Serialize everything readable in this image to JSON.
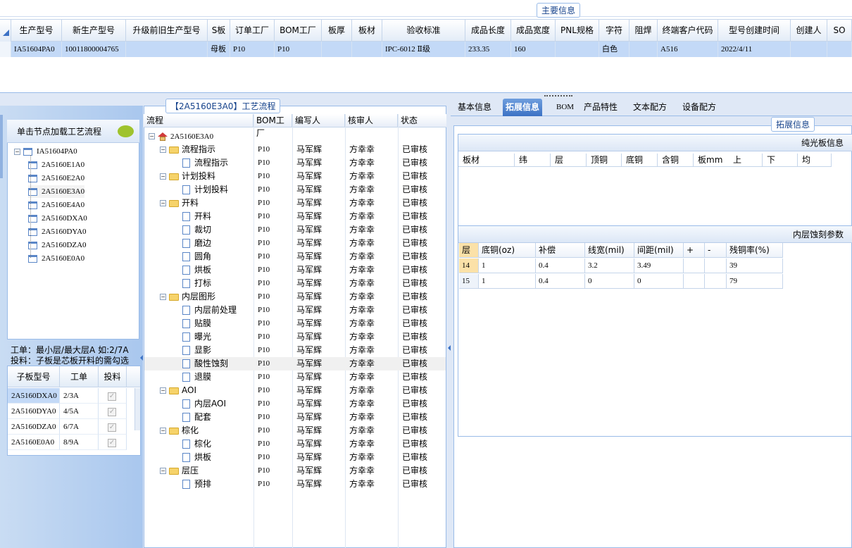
{
  "top": {
    "title": "主要信息",
    "columns": [
      "生产型号",
      "新生产型号",
      "升级前旧生产型号",
      "S板",
      "订单工厂",
      "BOM工厂",
      "板厚",
      "板材",
      "验收标准",
      "成品长度",
      "成品宽度",
      "PNL规格",
      "字符",
      "阻焊",
      "终端客户代码",
      "型号创建时间",
      "创建人",
      "SO"
    ],
    "row": [
      "IA51604PA0",
      "10011800004765",
      "",
      "母板",
      "P10",
      "P10",
      "",
      "",
      "IPC-6012 Ⅱ级",
      "233.35",
      "160",
      "",
      "白色",
      "",
      "A516",
      "2022/4/11",
      "",
      ""
    ]
  },
  "left": {
    "load_button": "单击节点加载工艺流程",
    "tree_root": "IA51604PA0",
    "tree_children": [
      "2A5160E1A0",
      "2A5160E2A0",
      "2A5160E3A0",
      "2A5160E4A0",
      "2A5160DXA0",
      "2A5160DYA0",
      "2A5160DZA0",
      "2A5160E0A0"
    ],
    "note1": "工单：最小层/最大层A 如:2/7A",
    "note2": "投料：子板是芯板开料的需勾选",
    "grid_headers": [
      "子板型号",
      "工单",
      "投料"
    ],
    "grid_rows": [
      {
        "model": "2A5160DXA0",
        "order": "2/3A",
        "check": "✓"
      },
      {
        "model": "2A5160DYA0",
        "order": "4/5A",
        "check": "✓"
      },
      {
        "model": "2A5160DZA0",
        "order": "6/7A",
        "check": "✓"
      },
      {
        "model": "2A5160E0A0",
        "order": "8/9A",
        "check": "✓"
      }
    ]
  },
  "mid": {
    "title": "【2A5160E3A0】工艺流程",
    "headers": [
      "流程",
      "BOM工厂",
      "编写人",
      "核审人",
      "状态"
    ],
    "root": "2A5160E3A0",
    "factory": "P10",
    "writer": "马军辉",
    "checker": "方幸幸",
    "status": "已审核",
    "rows": [
      {
        "label": "流程指示",
        "kind": "folder"
      },
      {
        "label": "流程指示",
        "kind": "doc"
      },
      {
        "label": "计划投料",
        "kind": "folder"
      },
      {
        "label": "计划投料",
        "kind": "doc"
      },
      {
        "label": "开料",
        "kind": "folder"
      },
      {
        "label": "开料",
        "kind": "doc"
      },
      {
        "label": "裁切",
        "kind": "doc"
      },
      {
        "label": "磨边",
        "kind": "doc"
      },
      {
        "label": "圆角",
        "kind": "doc"
      },
      {
        "label": "烘板",
        "kind": "doc"
      },
      {
        "label": "打标",
        "kind": "doc"
      },
      {
        "label": "内层图形",
        "kind": "folder"
      },
      {
        "label": "内层前处理",
        "kind": "doc"
      },
      {
        "label": "贴膜",
        "kind": "doc"
      },
      {
        "label": "曝光",
        "kind": "doc"
      },
      {
        "label": "显影",
        "kind": "doc"
      },
      {
        "label": "酸性蚀刻",
        "kind": "doc"
      },
      {
        "label": "退膜",
        "kind": "doc"
      },
      {
        "label": "AOI",
        "kind": "folder"
      },
      {
        "label": "内层AOI",
        "kind": "doc"
      },
      {
        "label": "配套",
        "kind": "doc"
      },
      {
        "label": "棕化",
        "kind": "folder"
      },
      {
        "label": "棕化",
        "kind": "doc"
      },
      {
        "label": "烘板",
        "kind": "doc"
      },
      {
        "label": "层压",
        "kind": "folder"
      },
      {
        "label": "预排",
        "kind": "doc"
      }
    ]
  },
  "right": {
    "tabs": [
      "基本信息",
      "拓展信息",
      "BOM",
      "产品特性",
      "文本配方",
      "设备配方"
    ],
    "active_tab": "拓展信息",
    "panel_title": "拓展信息",
    "section1_title": "纯光板信息",
    "section1_headers": [
      "板材",
      "纬",
      "层",
      "顶铜",
      "底铜",
      "含铜",
      "板mm",
      "上",
      "下",
      "均"
    ],
    "section2_title": "内层蚀刻参数",
    "section2_headers": [
      "层",
      "底铜(oz)",
      "补偿",
      "线宽(mil)",
      "间距(mil)",
      "+",
      "-",
      "残铜率(%)"
    ],
    "section2_rows": [
      [
        "14",
        "1",
        "0.4",
        "3.2",
        "3.49",
        "",
        "",
        "39"
      ],
      [
        "15",
        "1",
        "0.4",
        "0",
        "0",
        "",
        "",
        "79"
      ]
    ]
  }
}
